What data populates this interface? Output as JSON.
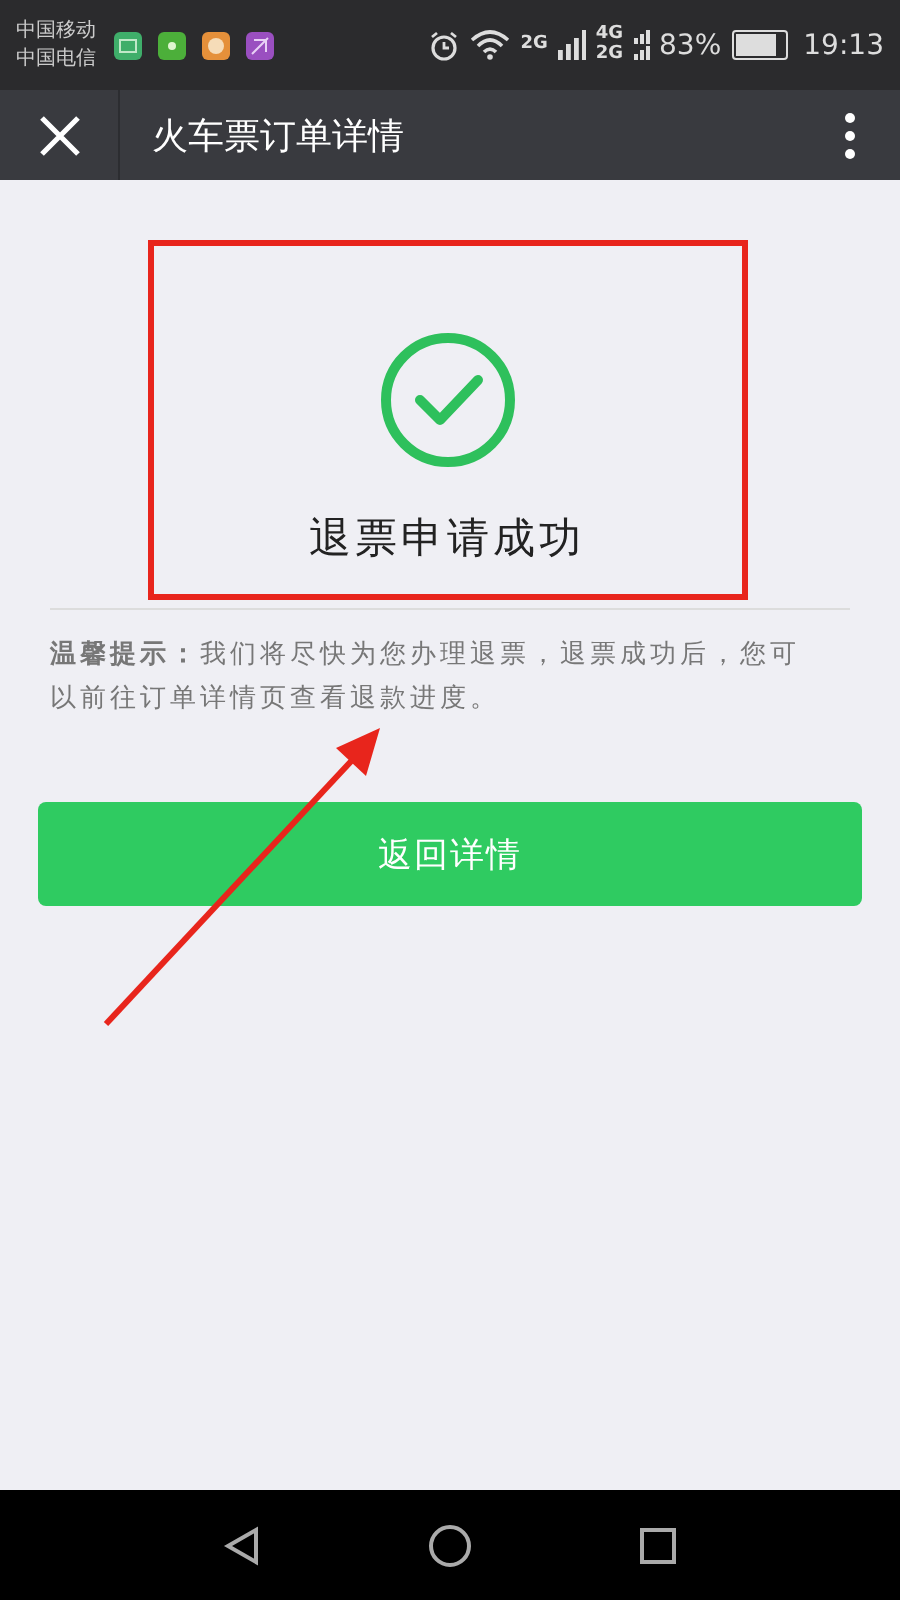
{
  "status_bar": {
    "carriers": [
      "中国移动",
      "中国电信"
    ],
    "network_2g": "2G",
    "network_4g": "4G",
    "network_2g_second": "2G",
    "battery_percent": "83%",
    "time": "19:13"
  },
  "header": {
    "title": "火车票订单详情"
  },
  "result": {
    "message": "退票申请成功"
  },
  "notice": "**温馨提示：**我们将尽快为您办理退票，退票成功后，您可以前往订单详情页查看退款进度。",
  "buttons": [
    "返回详情"
  ]
}
